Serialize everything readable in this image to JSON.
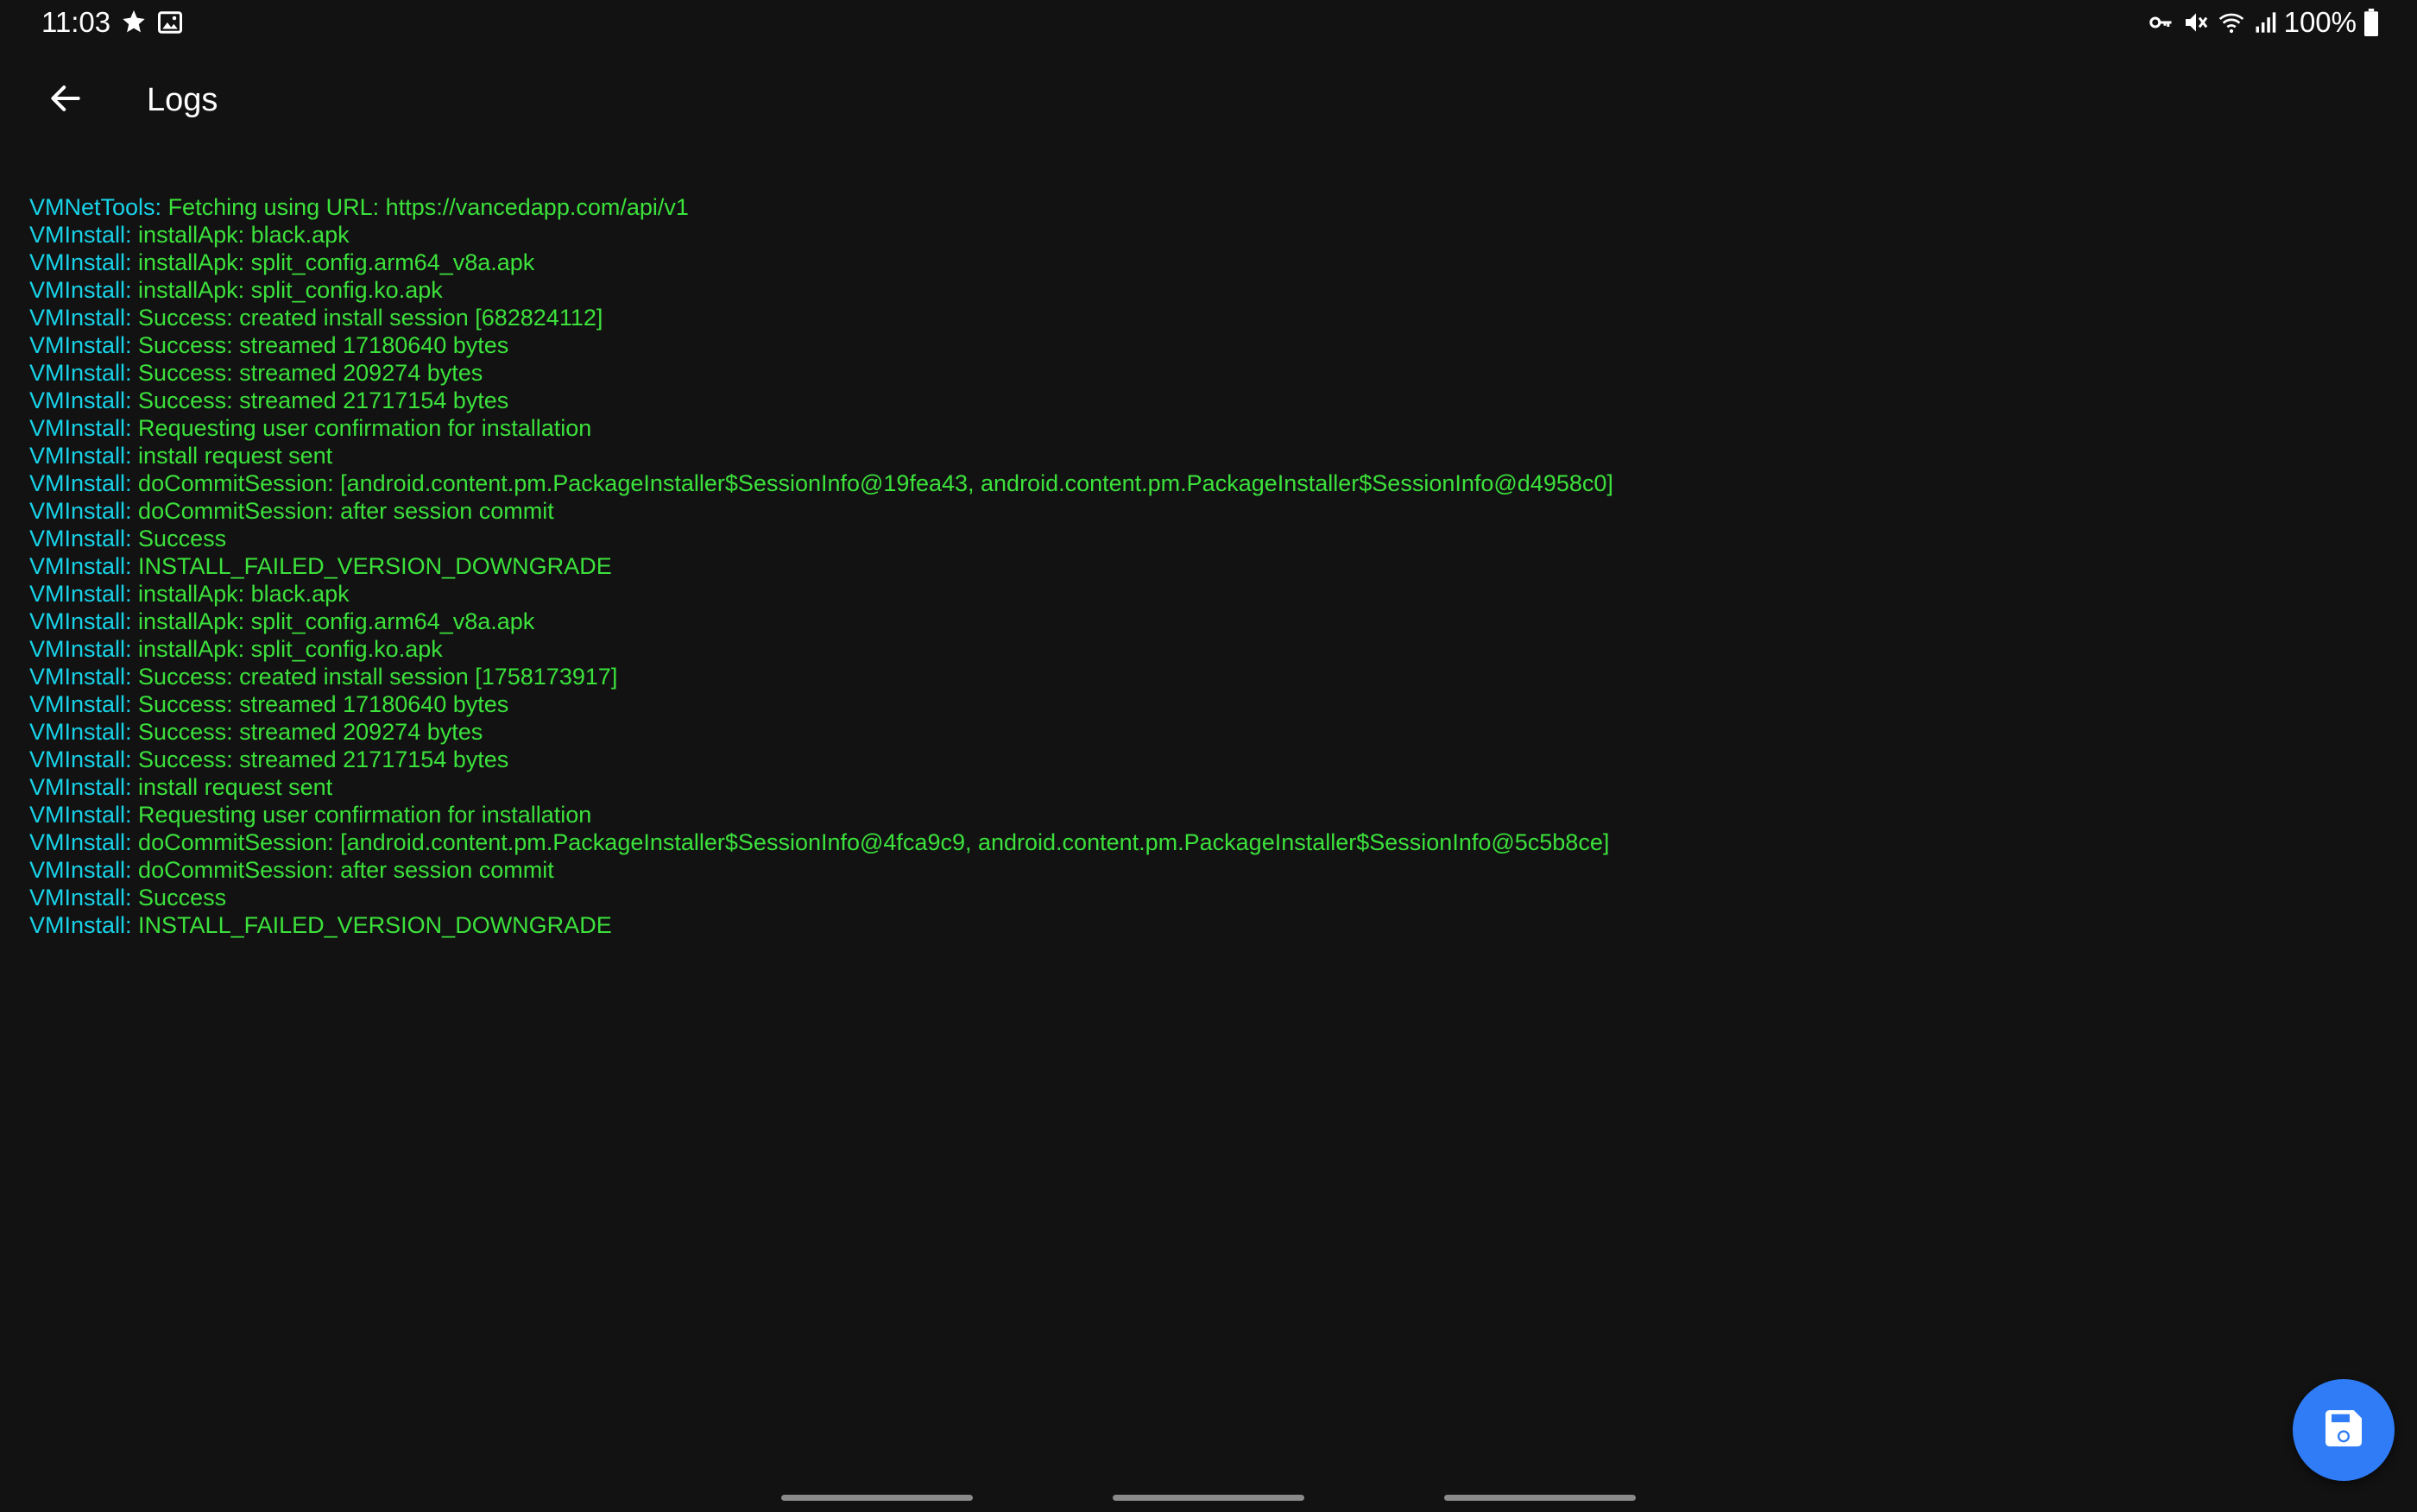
{
  "status_bar": {
    "time": "11:03",
    "left_icons": [
      "pinwheel-icon",
      "image-icon"
    ],
    "right_icons": [
      "vpn-key-icon",
      "mute-icon",
      "wifi-icon",
      "signal-icon"
    ],
    "battery_text": "100%",
    "battery_icon": "battery-full-icon"
  },
  "app_bar": {
    "back_icon": "arrow-left-icon",
    "title": "Logs"
  },
  "logs": [
    {
      "tag": "VMNetTools:",
      "msg": " Fetching using URL: https://vancedapp.com/api/v1"
    },
    {
      "tag": "VMInstall:",
      "msg": " installApk: black.apk"
    },
    {
      "tag": "VMInstall:",
      "msg": " installApk: split_config.arm64_v8a.apk"
    },
    {
      "tag": "VMInstall:",
      "msg": " installApk: split_config.ko.apk"
    },
    {
      "tag": "VMInstall:",
      "msg": " Success: created install session [682824112]"
    },
    {
      "tag": "VMInstall:",
      "msg": " Success: streamed 17180640 bytes"
    },
    {
      "tag": "VMInstall:",
      "msg": " Success: streamed 209274 bytes"
    },
    {
      "tag": "VMInstall:",
      "msg": " Success: streamed 21717154 bytes"
    },
    {
      "tag": "VMInstall:",
      "msg": " Requesting user confirmation for installation"
    },
    {
      "tag": "VMInstall:",
      "msg": " install request sent"
    },
    {
      "tag": "VMInstall:",
      "msg": " doCommitSession: [android.content.pm.PackageInstaller$SessionInfo@19fea43, android.content.pm.PackageInstaller$SessionInfo@d4958c0]"
    },
    {
      "tag": "VMInstall:",
      "msg": " doCommitSession: after session commit"
    },
    {
      "tag": "VMInstall:",
      "msg": " Success"
    },
    {
      "tag": "VMInstall:",
      "msg": " INSTALL_FAILED_VERSION_DOWNGRADE"
    },
    {
      "tag": "VMInstall:",
      "msg": " installApk: black.apk"
    },
    {
      "tag": "VMInstall:",
      "msg": " installApk: split_config.arm64_v8a.apk"
    },
    {
      "tag": "VMInstall:",
      "msg": " installApk: split_config.ko.apk"
    },
    {
      "tag": "VMInstall:",
      "msg": " Success: created install session [1758173917]"
    },
    {
      "tag": "VMInstall:",
      "msg": " Success: streamed 17180640 bytes"
    },
    {
      "tag": "VMInstall:",
      "msg": " Success: streamed 209274 bytes"
    },
    {
      "tag": "VMInstall:",
      "msg": " Success: streamed 21717154 bytes"
    },
    {
      "tag": "VMInstall:",
      "msg": " install request sent"
    },
    {
      "tag": "VMInstall:",
      "msg": " Requesting user confirmation for installation"
    },
    {
      "tag": "VMInstall:",
      "msg": " doCommitSession: [android.content.pm.PackageInstaller$SessionInfo@4fca9c9, android.content.pm.PackageInstaller$SessionInfo@5c5b8ce]"
    },
    {
      "tag": "VMInstall:",
      "msg": " doCommitSession: after session commit"
    },
    {
      "tag": "VMInstall:",
      "msg": " Success"
    },
    {
      "tag": "VMInstall:",
      "msg": " INSTALL_FAILED_VERSION_DOWNGRADE"
    }
  ],
  "fab": {
    "icon": "save-icon"
  },
  "colors": {
    "background": "#121212",
    "log_tag": "#18d3e8",
    "log_message": "#3ce13c",
    "fab": "#2f7cf6"
  }
}
